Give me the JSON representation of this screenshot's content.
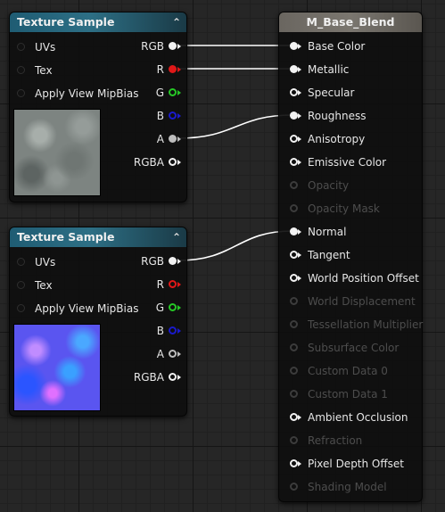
{
  "colors": {
    "red_pin": "#e01818",
    "green_pin": "#26c826",
    "blue_pin": "#1a1acc",
    "alpha_pin": "#bdbdbd",
    "wire": "#ffffff"
  },
  "texture_node_1": {
    "title": "Texture Sample",
    "collapse_icon": "chevron-up-icon",
    "inputs": [
      "UVs",
      "Tex",
      "Apply View MipBias"
    ],
    "outputs": [
      "RGB",
      "R",
      "G",
      "B",
      "A",
      "RGBA"
    ],
    "thumbnail": "rock-texture-thumbnail"
  },
  "texture_node_2": {
    "title": "Texture Sample",
    "collapse_icon": "chevron-up-icon",
    "inputs": [
      "UVs",
      "Tex",
      "Apply View MipBias"
    ],
    "outputs": [
      "RGB",
      "R",
      "G",
      "B",
      "A",
      "RGBA"
    ],
    "thumbnail": "normal-map-thumbnail"
  },
  "material_node": {
    "title": "M_Base_Blend",
    "pins": [
      "Base Color",
      "Metallic",
      "Specular",
      "Roughness",
      "Anisotropy",
      "Emissive Color",
      "Opacity",
      "Opacity Mask",
      "Normal",
      "Tangent",
      "World Position Offset",
      "World Displacement",
      "Tessellation Multiplier",
      "Subsurface Color",
      "Custom Data 0",
      "Custom Data 1",
      "Ambient Occlusion",
      "Refraction",
      "Pixel Depth Offset",
      "Shading Model"
    ]
  }
}
